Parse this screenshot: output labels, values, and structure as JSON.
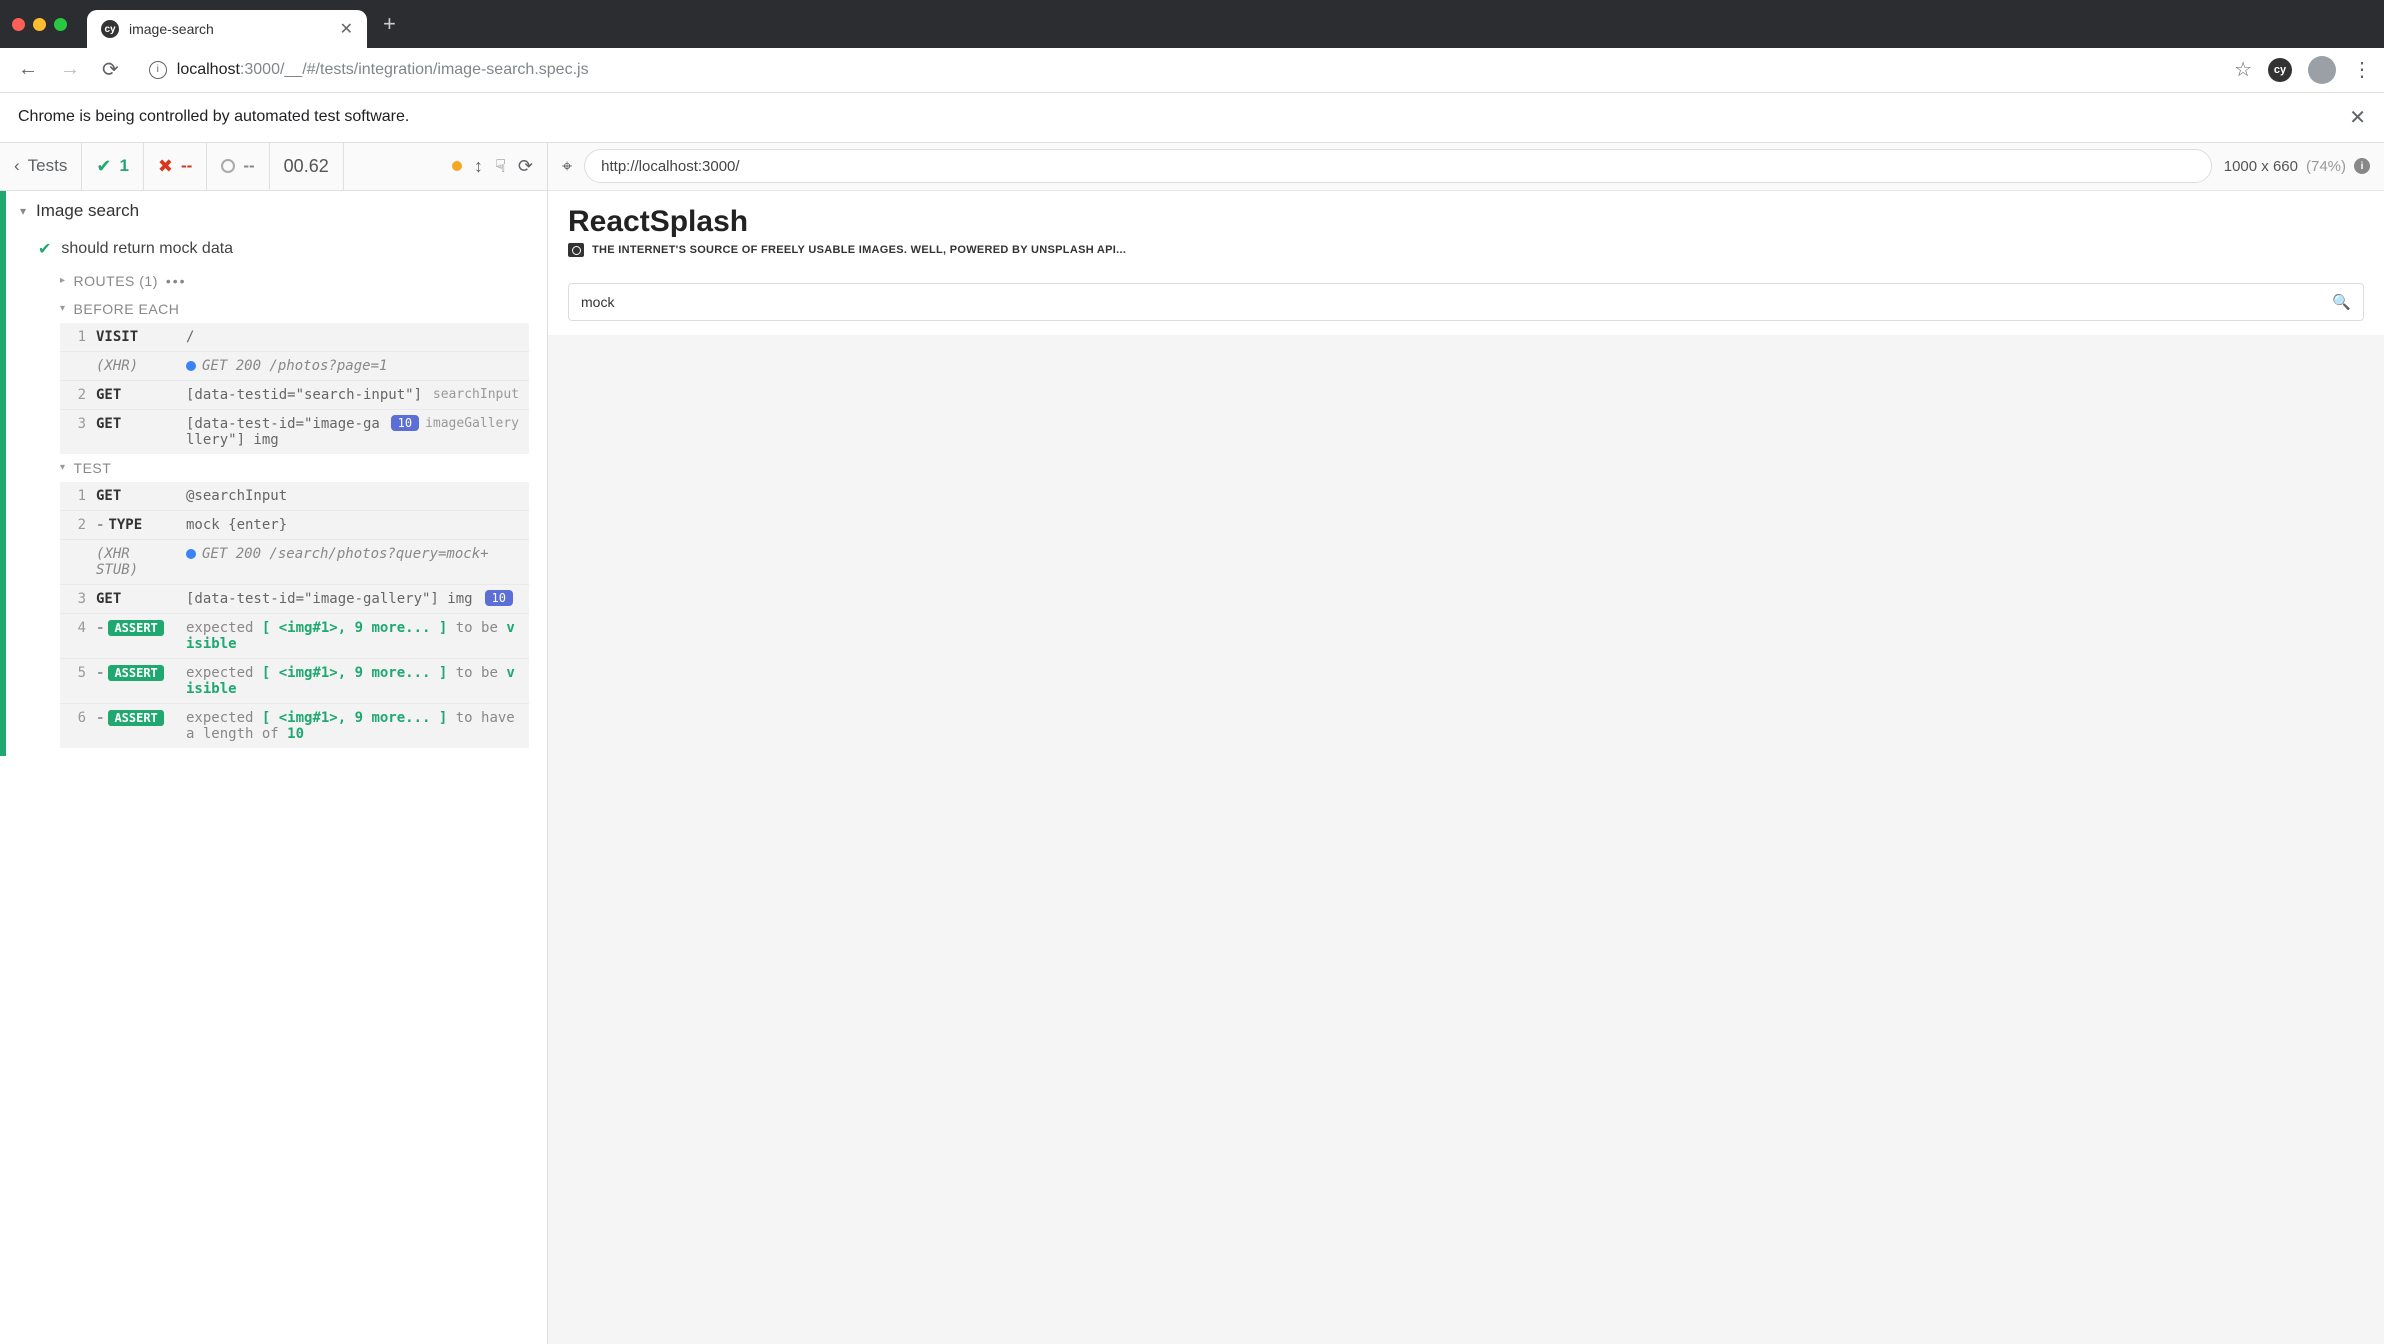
{
  "browser": {
    "tab_title": "image-search",
    "url_host": "localhost",
    "url_rest": ":3000/__/#/tests/integration/image-search.spec.js"
  },
  "banner": {
    "text": "Chrome is being controlled by automated test software."
  },
  "reporter": {
    "back_label": "Tests",
    "passed": "1",
    "failed": "--",
    "skipped": "--",
    "duration": "00.62",
    "suite_title": "Image search",
    "test_title": "should return mock data",
    "routes_label": "ROUTES (1)",
    "before_each_label": "BEFORE EACH",
    "test_label": "TEST",
    "before_each": [
      {
        "num": "1",
        "name": "VISIT",
        "msg": "/"
      },
      {
        "num": "",
        "name": "(XHR)",
        "xhr": true,
        "dot": true,
        "msg": "GET 200 /photos?page=1"
      },
      {
        "num": "2",
        "name": "GET",
        "msg": "[data-testid=\"search-input\"]",
        "alias": "searchInput"
      },
      {
        "num": "3",
        "name": "GET",
        "msg": "[data-test-id=\"image-gallery\"] img",
        "badge": "10",
        "alias": "imageGallery"
      }
    ],
    "test_cmds": [
      {
        "num": "1",
        "name": "GET",
        "msg": "@searchInput"
      },
      {
        "num": "2",
        "dash": true,
        "name": "TYPE",
        "msg": "mock {enter}"
      },
      {
        "num": "",
        "name": "(XHR STUB)",
        "xhr": true,
        "dot": true,
        "msg": "GET 200 /search/photos?query=mock+"
      },
      {
        "num": "3",
        "name": "GET",
        "msg": "[data-test-id=\"image-gallery\"] img",
        "badge": "10"
      },
      {
        "num": "4",
        "dash": true,
        "assert": true,
        "parts": [
          "expected",
          " [ <img#1>, 9 more... ] ",
          "to be",
          " visible"
        ]
      },
      {
        "num": "5",
        "dash": true,
        "assert": true,
        "parts": [
          "expected",
          " [ <img#1>, 9 more... ] ",
          "to be",
          " visible"
        ]
      },
      {
        "num": "6",
        "dash": true,
        "assert": true,
        "parts": [
          "expected",
          " [ <img#1>, 9 more... ] ",
          "to have a length of",
          " 10"
        ]
      }
    ]
  },
  "aut": {
    "url": "http://localhost:3000/",
    "viewport": "1000 x 660",
    "scale": "(74%)",
    "app_title": "ReactSplash",
    "tagline": "THE INTERNET'S SOURCE OF FREELY USABLE IMAGES. WELL, POWERED BY UNSPLASH API...",
    "search_value": "mock"
  }
}
